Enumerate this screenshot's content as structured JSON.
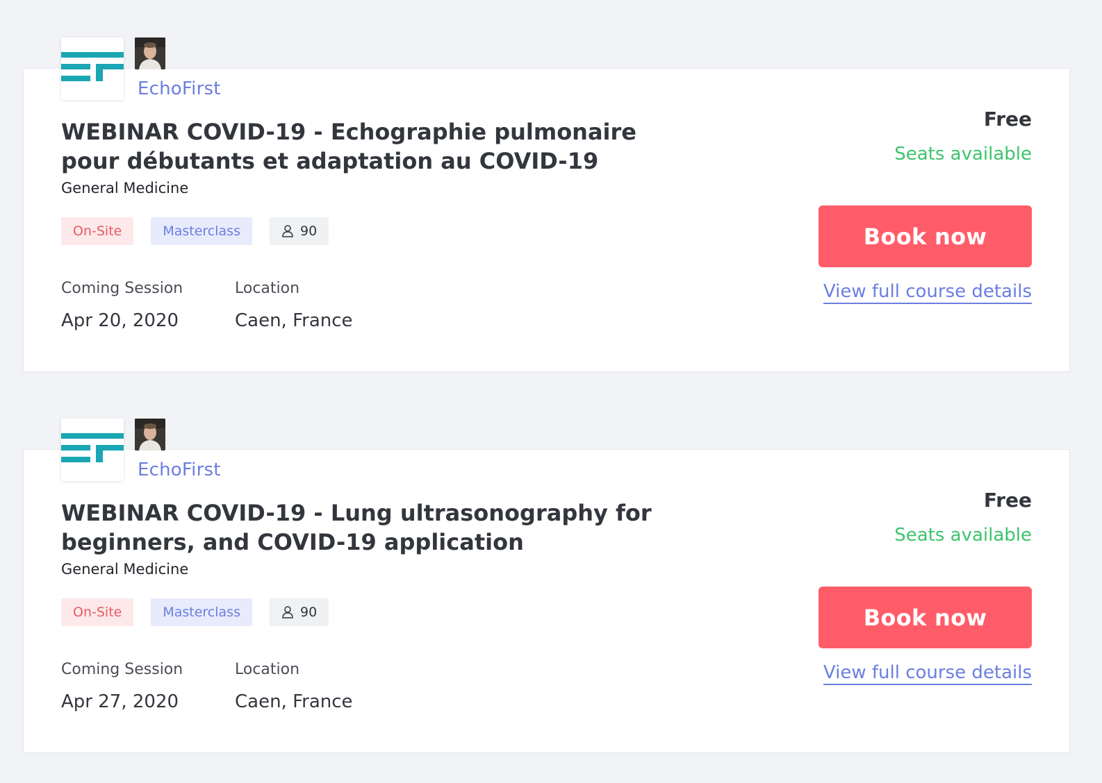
{
  "colors": {
    "page_bg": "#f2f3f6",
    "accent_blue": "#6b7ee0",
    "book_button": "#ff5c69",
    "available_green": "#3ec46d",
    "onsite_tag_text": "#ea5a64",
    "logo_teal": "#1aa6b3"
  },
  "courses": [
    {
      "provider": "EchoFirst",
      "logo_icon": "echofirst-logo",
      "avatar_icon": "instructor-avatar",
      "title": "WEBINAR COVID-19 - Echographie pulmonaire pour débutants et adaptation au COVID-19",
      "category": "General Medicine",
      "tags": {
        "delivery": "On-Site",
        "format": "Masterclass",
        "seats_icon": "person-icon",
        "seats": "90"
      },
      "session_label": "Coming Session",
      "session_date": "Apr 20, 2020",
      "location_label": "Location",
      "location": "Caen, France",
      "price": "Free",
      "availability": "Seats available",
      "book_label": "Book now",
      "details_label": "View full course details"
    },
    {
      "provider": "EchoFirst",
      "logo_icon": "echofirst-logo",
      "avatar_icon": "instructor-avatar",
      "title": "WEBINAR COVID-19 - Lung ultrasonography for beginners, and COVID-19 application",
      "category": "General Medicine",
      "tags": {
        "delivery": "On-Site",
        "format": "Masterclass",
        "seats_icon": "person-icon",
        "seats": "90"
      },
      "session_label": "Coming Session",
      "session_date": "Apr 27, 2020",
      "location_label": "Location",
      "location": "Caen, France",
      "price": "Free",
      "availability": "Seats available",
      "book_label": "Book now",
      "details_label": "View full course details"
    }
  ]
}
